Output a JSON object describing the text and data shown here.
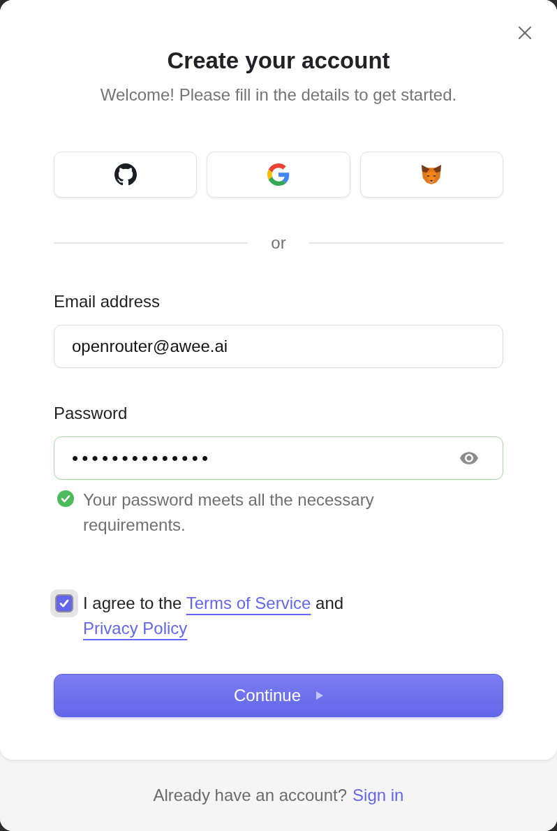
{
  "dialog": {
    "title": "Create your account",
    "subtitle": "Welcome! Please fill in the details to get started."
  },
  "social_buttons": [
    {
      "kind": "github"
    },
    {
      "kind": "google"
    },
    {
      "kind": "metamask"
    }
  ],
  "divider": {
    "label": "or"
  },
  "fields": [
    {
      "kind": "email",
      "label": "Email address",
      "value": "openrouter@awee.ai"
    },
    {
      "kind": "password",
      "label": "Password",
      "value": "••••••••••••••",
      "valid": true,
      "message": {
        "kind": "success",
        "text": "Your password meets all the necessary requirements."
      }
    }
  ],
  "consent": {
    "checked": true,
    "parts": [
      {
        "kind": "text",
        "text": "I agree to the"
      },
      {
        "kind": "link",
        "text": "Terms of Service"
      },
      {
        "kind": "text",
        "text": "and"
      },
      {
        "kind": "link",
        "text": "Privacy Policy"
      }
    ]
  },
  "submit": {
    "label": "Continue"
  },
  "footer": {
    "text": "Already have an account?",
    "link": "Sign in"
  }
}
